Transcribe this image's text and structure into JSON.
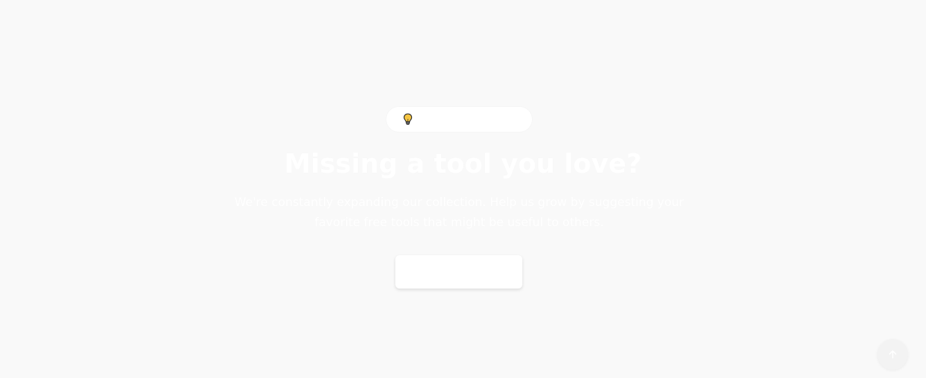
{
  "badge": {
    "icon": "lightbulb-icon",
    "label": ""
  },
  "headline": "Missing a tool you love?",
  "description": "We're constantly expanding our collection. Help us grow by suggesting your favorite free tools that might be useful to others.",
  "cta": {
    "label": ""
  },
  "scroll_top": {
    "icon": "arrow-up-icon"
  },
  "colors": {
    "background": "#f9f9f9",
    "bulb_fill": "#f5c542",
    "bulb_outline": "#2b2b2b"
  }
}
